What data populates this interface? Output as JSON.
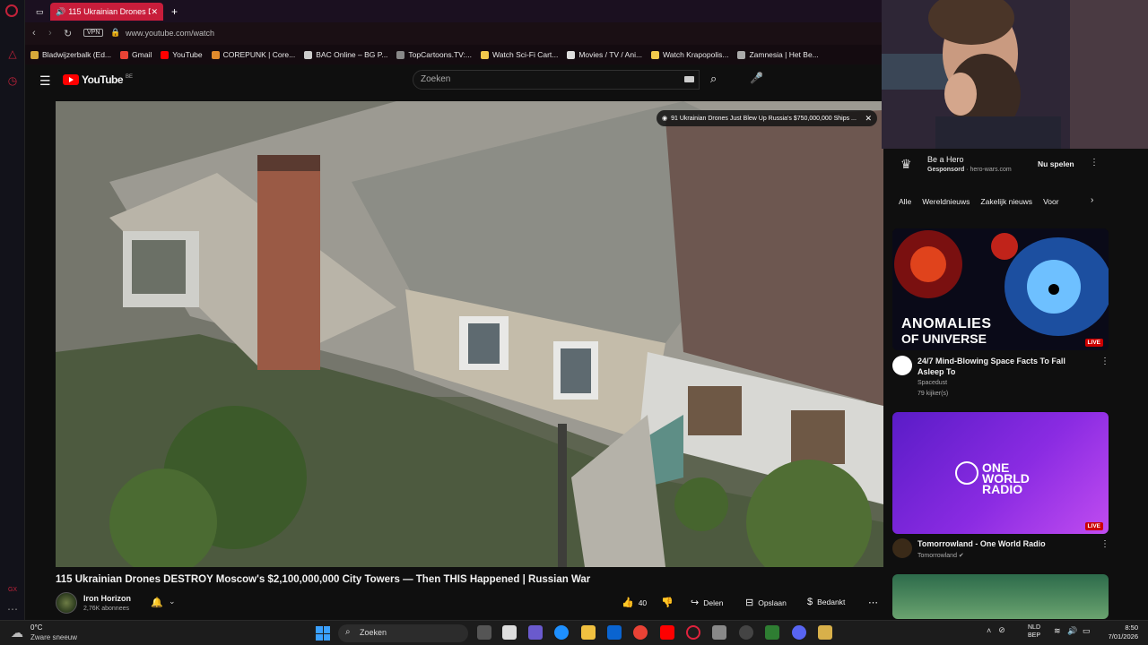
{
  "browser": {
    "tab": {
      "title": "115 Ukrainian Drones D"
    },
    "url": "www.youtube.com/watch",
    "vpn": "VPN",
    "bookmarks": [
      {
        "label": "Bladwijzerbalk (Ed...",
        "color": "#d7a93a"
      },
      {
        "label": "Gmail",
        "color": "#ea4335"
      },
      {
        "label": "YouTube",
        "color": "#ff0000"
      },
      {
        "label": "COREPUNK | Core...",
        "color": "#e08a2c"
      },
      {
        "label": "BAC Online – BG P...",
        "color": "#cccccc"
      },
      {
        "label": "TopCartoons.TV:...",
        "color": "#888888"
      },
      {
        "label": "Watch Sci-Fi Cart...",
        "color": "#f2c94c"
      },
      {
        "label": "Movies / TV / Ani...",
        "color": "#dddddd"
      },
      {
        "label": "Watch Krapopolis...",
        "color": "#f2c94c"
      },
      {
        "label": "Zamnesia | Het Be...",
        "color": "#aaaaaa"
      }
    ]
  },
  "youtube": {
    "logo_text": "YouTube",
    "logo_region": "BE",
    "search_placeholder": "Zoeken",
    "video_banner": "91 Ukrainian Drones Just Blew Up Russia's $750,000,000 Ships ...",
    "video_title": "115 Ukrainian Drones DESTROY Moscow's $2,100,000,000 City Towers — Then THIS Happened | Russian War",
    "channel": {
      "name": "Iron Horizon",
      "subscribers": "2,76K abonnees"
    },
    "actions": {
      "likes": "40",
      "share": "Delen",
      "save": "Opslaan",
      "thanks": "Bedankt"
    }
  },
  "sidebar": {
    "ad": {
      "title": "Be a Hero",
      "sponsored": "Gesponsord",
      "domain": "hero-wars.com",
      "cta": "Nu spelen"
    },
    "chips": [
      "Alle",
      "Wereldnieuws",
      "Zakelijk nieuws",
      "Voor"
    ],
    "videos": [
      {
        "title": "24/7 Mind-Blowing Space Facts To Fall Asleep To",
        "channel": "Spacedust",
        "meta": "79 kijker(s)",
        "thumb_line1": "ANOMALIES",
        "thumb_line2": "OF UNIVERSE",
        "live": "LIVE"
      },
      {
        "title": "Tomorrowland - One World Radio",
        "channel": "Tomorrowland",
        "thumb_line1": "ONE WORLD RADIO",
        "live": "LIVE"
      }
    ]
  },
  "taskbar": {
    "temperature": "0°C",
    "condition": "Zware sneeuw",
    "search": "Zoeken",
    "lang": "NLD",
    "lang2": "BEP",
    "time": "8:50",
    "date": "7/01/2026"
  }
}
